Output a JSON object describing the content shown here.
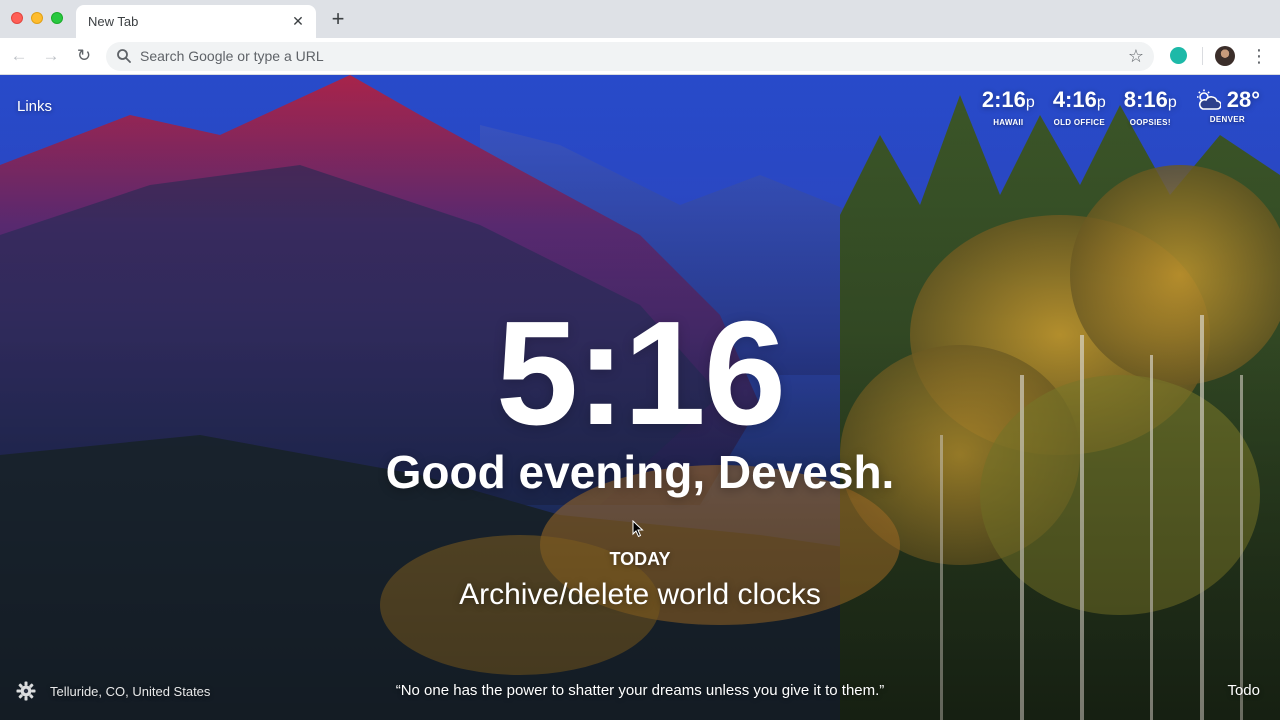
{
  "browser": {
    "tab_title": "New Tab",
    "tab_close": "✕",
    "new_tab": "+",
    "omnibox_placeholder": "Search Google or type a URL",
    "nav_back": "←",
    "nav_forward": "→",
    "reload": "↻",
    "bookmark": "☆",
    "menu": "⋮"
  },
  "dashboard": {
    "links_label": "Links",
    "world_clocks": [
      {
        "time": "2:16",
        "ampm": "p",
        "label": "HAWAII"
      },
      {
        "time": "4:16",
        "ampm": "p",
        "label": "OLD OFFICE"
      },
      {
        "time": "8:16",
        "ampm": "p",
        "label": "OOPSIES!"
      }
    ],
    "weather": {
      "temperature": "28°",
      "location": "DENVER",
      "icon": "partly-cloudy-sun-icon"
    },
    "time": "5:16",
    "greeting": "Good evening, Devesh.",
    "focus": {
      "label": "TODAY",
      "text": "Archive/delete world clocks"
    },
    "photo_location": "Telluride, CO, United States",
    "quote": "“No one has the power to shatter your dreams unless you give it to them.”",
    "todo_label": "Todo"
  },
  "icons": {
    "settings": "gear-icon",
    "search": "search-icon",
    "extension": "extension-icon",
    "profile": "avatar"
  },
  "colors": {
    "chrome_bg": "#dee1e6",
    "extension_teal": "#1db9a8",
    "sky_blue": "#2a4fd6"
  }
}
